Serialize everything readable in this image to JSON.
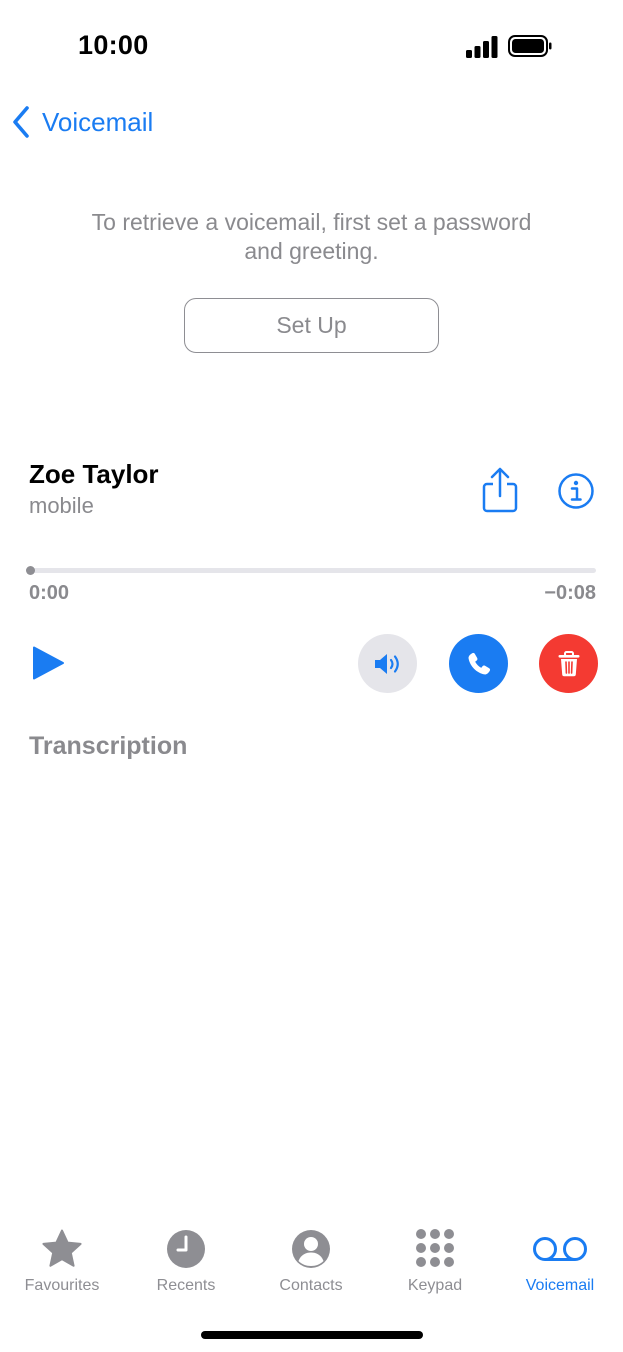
{
  "status_bar": {
    "time": "10:00"
  },
  "nav": {
    "back_label": "Voicemail"
  },
  "setup": {
    "message": "To retrieve a voicemail, first set a password and greeting.",
    "button_label": "Set Up"
  },
  "voicemail": {
    "caller_name": "Zoe Taylor",
    "caller_type": "mobile",
    "elapsed": "0:00",
    "remaining": "−0:08",
    "progress_fraction": 0.0
  },
  "transcription_label": "Transcription",
  "tab_bar": {
    "tabs": [
      {
        "label": "Favourites",
        "icon": "star-icon",
        "active": false
      },
      {
        "label": "Recents",
        "icon": "clock-icon",
        "active": false
      },
      {
        "label": "Contacts",
        "icon": "person-circle-icon",
        "active": false
      },
      {
        "label": "Keypad",
        "icon": "keypad-icon",
        "active": false
      },
      {
        "label": "Voicemail",
        "icon": "voicemail-icon",
        "active": true
      }
    ]
  },
  "colors": {
    "accent": "#1a7cf2",
    "destructive": "#f43a32",
    "secondary_text": "#8a8a8e"
  }
}
